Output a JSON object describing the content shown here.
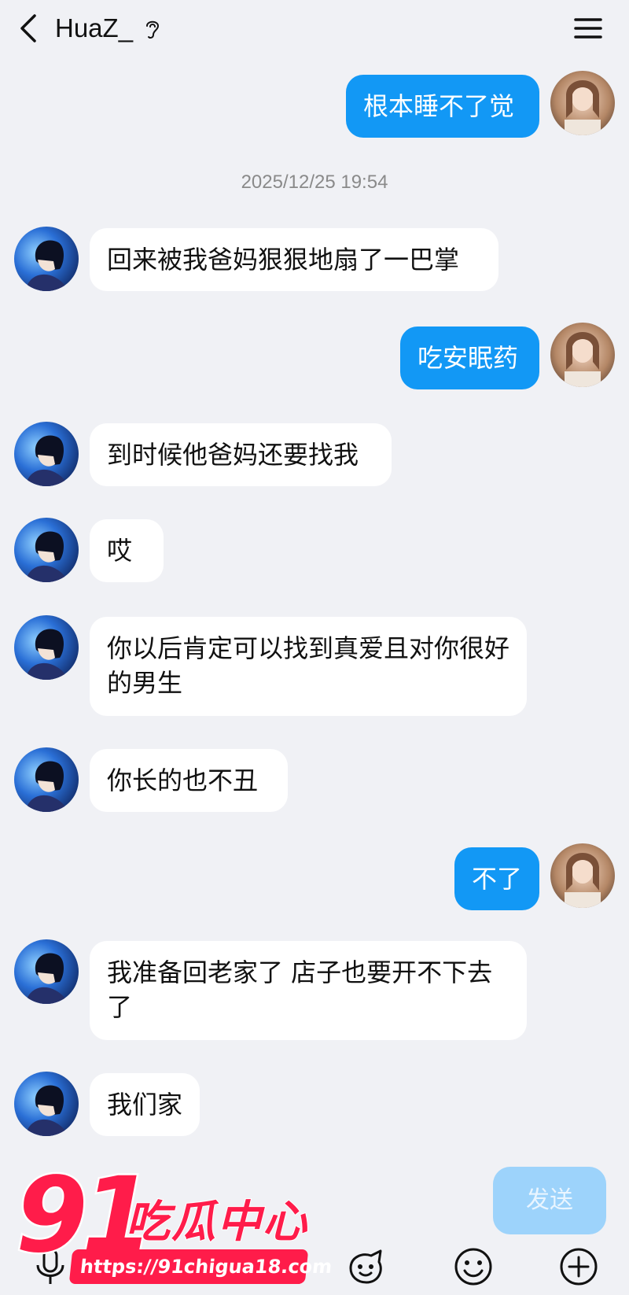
{
  "header": {
    "title": "HuaZ_",
    "back_icon": "chevron-left-icon",
    "ear_icon": "ear-icon",
    "menu_icon": "hamburger-menu-icon"
  },
  "colors": {
    "background": "#f0f1f5",
    "self_bubble": "#1298f5",
    "other_bubble": "#ffffff",
    "send_button": "#9dd3fb",
    "watermark": "#ff1c4a"
  },
  "chat": {
    "timestamp": "2025/12/25 19:54",
    "messages": [
      {
        "from": "self",
        "text": "根本睡不了觉"
      },
      {
        "from": "other",
        "text": "回来被我爸妈狠狠地扇了一巴掌"
      },
      {
        "from": "self",
        "text": "吃安眠药"
      },
      {
        "from": "other",
        "text": "到时候他爸妈还要找我"
      },
      {
        "from": "other",
        "text": "哎"
      },
      {
        "from": "other",
        "text": "你以后肯定可以找到真爱且对你很好的男生"
      },
      {
        "from": "other",
        "text": "你长的也不丑"
      },
      {
        "from": "self",
        "text": "不了"
      },
      {
        "from": "other",
        "text": "我准备回老家了 店子也要开不下去了"
      },
      {
        "from": "other",
        "text": "我们家"
      }
    ]
  },
  "input": {
    "send_label": "发送",
    "toolbar_icons": [
      "mic-icon",
      "image-icon",
      "sticker-face-icon",
      "emoji-icon",
      "plus-icon"
    ]
  },
  "watermark": {
    "number": "91",
    "text": "吃瓜中心",
    "url": "https://91chigua18.com"
  }
}
